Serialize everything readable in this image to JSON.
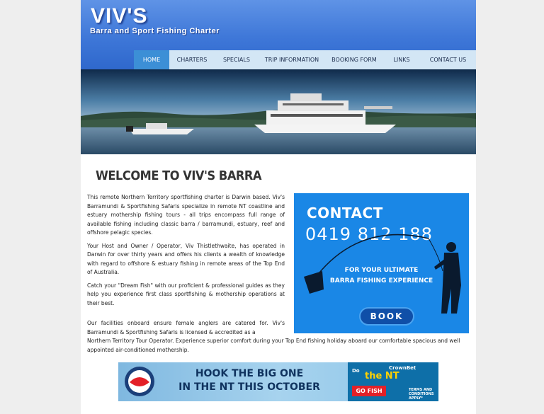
{
  "header": {
    "title": "VIV'S",
    "subtitle": "Barra and Sport Fishing Charter"
  },
  "nav": {
    "items": [
      {
        "label": "HOME",
        "active": true
      },
      {
        "label": "CHARTERS",
        "active": false
      },
      {
        "label": "SPECIALS",
        "active": false
      },
      {
        "label": "TRIP INFORMATION",
        "active": false
      },
      {
        "label": "BOOKING FORM",
        "active": false
      },
      {
        "label": "LINKS",
        "active": false
      },
      {
        "label": "CONTACT US",
        "active": false
      }
    ]
  },
  "main": {
    "heading": "WELCOME TO VIV'S BARRA",
    "paragraphs": [
      "This remote Northern Territory sportfishing charter is Darwin based. Viv's Barramundi & Sportfishing Safaris specialize in remote NT coastline and estuary mothership fishing tours - all trips encompass full range of available fishing including classic barra / barramundi, estuary, reef and offshore pelagic species.",
      "Your Host and Owner / Operator, Viv Thistlethwaite, has operated in Darwin for over thirty years and offers his clients a wealth of knowledge with regard to offshore & estuary fishing in remote areas of the Top End of Australia.",
      "Catch your \"Dream Fish\" with our proficient & professional guides as they help you experience first class sportfishing & mothership operations at their best."
    ],
    "last_paragraph_narrow": "Our facilities onboard ensure female anglers are catered for. Viv's Barramundi & Sportfishing Safaris is licensed & accredited as a",
    "last_paragraph_wide": "Northern Territory Tour Operator. Experience superior comfort during your Top End fishing holiday aboard our comfortable spacious and well appointed air-conditioned mothership."
  },
  "contact_ad": {
    "title": "CONTACT",
    "phone": "0419 812 188",
    "tagline_1": "FOR YOUR ULTIMATE",
    "tagline_2": "BARRA FISHING EXPERIENCE",
    "button_label": "BOOK"
  },
  "promo_banner": {
    "line_1": "HOOK THE BIG ONE",
    "line_2": "IN THE NT THIS OCTOBER",
    "dont": "Do",
    "nt": "the NT",
    "sponsor": "CrownBet",
    "button_label": "GO FISH",
    "terms": "TERMS AND CONDITIONS APPLY*"
  },
  "colors": {
    "header_blue": "#3e77d8",
    "nav_bg": "#d3e6f5",
    "nav_active": "#3c8fd6",
    "contact_blue": "#1a87e6",
    "book_button": "#0f4fa8"
  }
}
